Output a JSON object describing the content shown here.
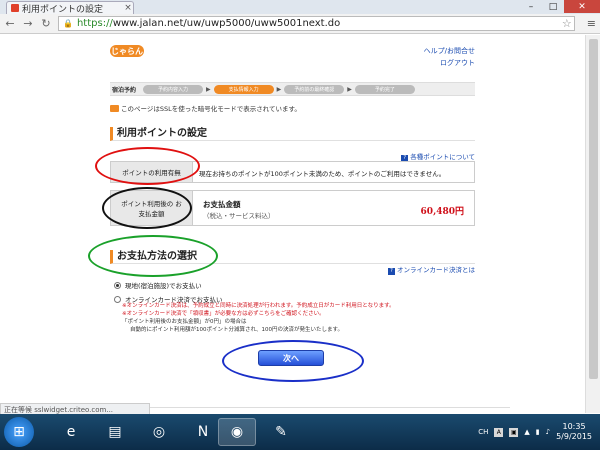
{
  "browser": {
    "tab_title": "利用ポイントの設定",
    "url_https": "https://",
    "url_rest": "www.jalan.net/uw/uwp5000/uww5001next.do",
    "status_text": "正在等候 sslwidget.criteo.com..."
  },
  "header": {
    "logo": "じゃらん",
    "help_link": "ヘルプ/お問合せ",
    "logout_link": "ログアウト"
  },
  "steps": {
    "label": "宿泊予約",
    "items": [
      "予約内容入力",
      "支払情報入力",
      "予約前の最終確認",
      "予約完了"
    ],
    "active_index": 1
  },
  "ssl_notice": "このページはSSLを使った暗号化モードで表示されています。",
  "points_section": {
    "title": "利用ポイントの設定",
    "link": "各種ポイントについて",
    "use_label": "ポイントの利用有無",
    "use_text": "現在お持ちのポイントが100ポイント未満のため、ポイントのご利用はできません。",
    "after_label": "ポイント利用後の お支払金額",
    "amount_title": "お支払金額",
    "amount_sub": "（税込・サービス料込）",
    "amount_value": "60,480円"
  },
  "payment_section": {
    "title": "お支払方法の選択",
    "link": "オンラインカード決済とは",
    "option_onsite": "現地(宿泊施設)でお支払い",
    "option_online": "オンラインカード決済でお支払い",
    "note1": "※オンラインカード決済は、予約成立と同時に決済処理が行われます。予約成立日がカード利用日となります。",
    "note2": "※オンラインカード決済で「領収書」が必要な方は必ずこちらをご確認ください。",
    "note3": "「ポイント利用後のお支払金額」が0円」の場合は",
    "note4": "自動的にポイント利用額が100ポイント分減算され、100円の決済が発生いたします。",
    "next_button": "次へ"
  },
  "taskbar": {
    "ime": "CH",
    "time": "10:35",
    "date": "5/9/2015"
  },
  "colors": {
    "accent": "#f08a24",
    "link": "#1a4bb0",
    "price": "#d0101a",
    "annotation_red": "#e01010",
    "annotation_black": "#111111",
    "annotation_green": "#1aa12a",
    "annotation_blue": "#1a2fc8"
  }
}
